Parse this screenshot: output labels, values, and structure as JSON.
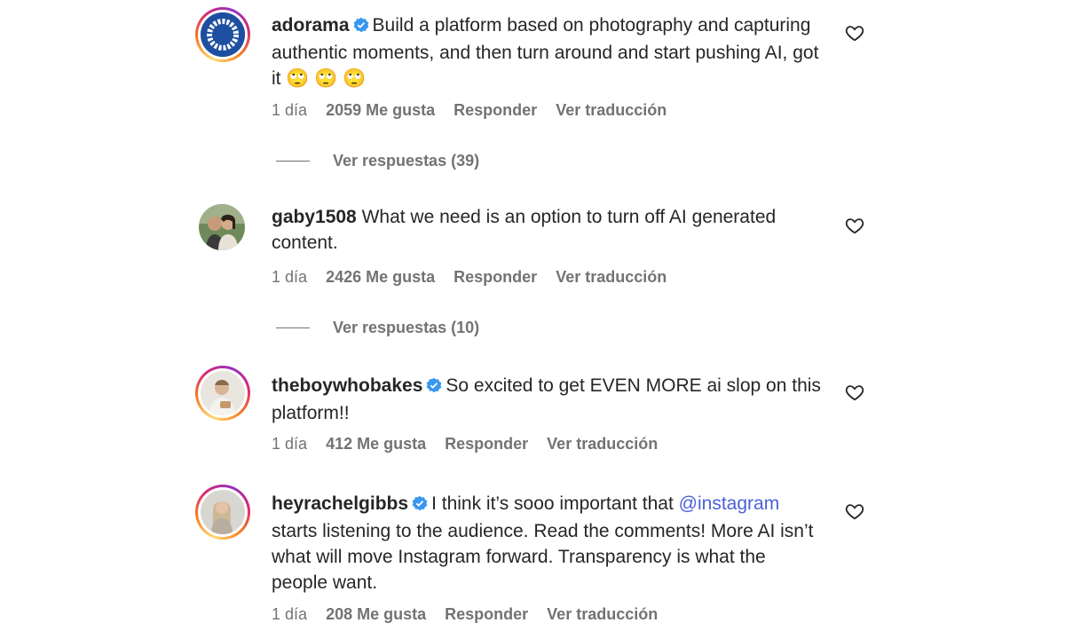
{
  "accent": {
    "link": "#4c60d9",
    "verified": "#3897f0",
    "muted": "#737373",
    "text": "#262626"
  },
  "comments": [
    {
      "username": "adorama",
      "verified": true,
      "text": "Build a platform based on photography and capturing authentic moments, and then turn around and start pushing AI, got it",
      "emoji": "🙄 🙄 🙄",
      "time": "1 día",
      "likes": "2059 Me gusta",
      "reply": "Responder",
      "translate": "Ver traducción",
      "replies_label": "Ver respuestas (39)",
      "avatar_icon": "adorama-logo-icon"
    },
    {
      "username": "gaby1508",
      "verified": false,
      "text": "What we need is an option to turn off AI generated content.",
      "time": "1 día",
      "likes": "2426 Me gusta",
      "reply": "Responder",
      "translate": "Ver traducción",
      "replies_label": "Ver respuestas (10)",
      "avatar_icon": "couple-photo-avatar"
    },
    {
      "username": "theboywhobakes",
      "verified": true,
      "text": "So excited to get EVEN MORE ai slop on this platform!!",
      "time": "1 día",
      "likes": "412 Me gusta",
      "reply": "Responder",
      "translate": "Ver traducción",
      "avatar_icon": "baker-photo-avatar"
    },
    {
      "username": "heyrachelgibbs",
      "verified": true,
      "text_before": "I think it’s sooo important that",
      "mention": "@instagram",
      "text_after": "starts listening to the audience. Read the comments! More AI isn’t what will move Instagram forward. Transparency is what the people want.",
      "time": "1 día",
      "likes": "208 Me gusta",
      "reply": "Responder",
      "translate": "Ver traducción",
      "avatar_icon": "woman-photo-avatar"
    }
  ]
}
